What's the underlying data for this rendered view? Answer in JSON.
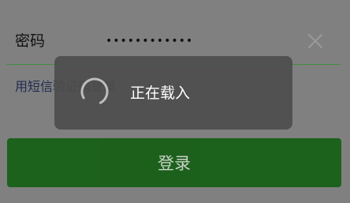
{
  "password_row": {
    "label": "密码",
    "value": "••••••••••••"
  },
  "sms_login_link": "用短信验证码登录",
  "login_button": "登录",
  "loading": {
    "text": "正在载入"
  },
  "icons": {
    "clear": "close-icon",
    "spinner": "loading-spinner-icon"
  },
  "colors": {
    "background": "#808080",
    "underline": "#3c8f3c",
    "login_button": "#145e14",
    "toast": "#4d4d4d"
  }
}
